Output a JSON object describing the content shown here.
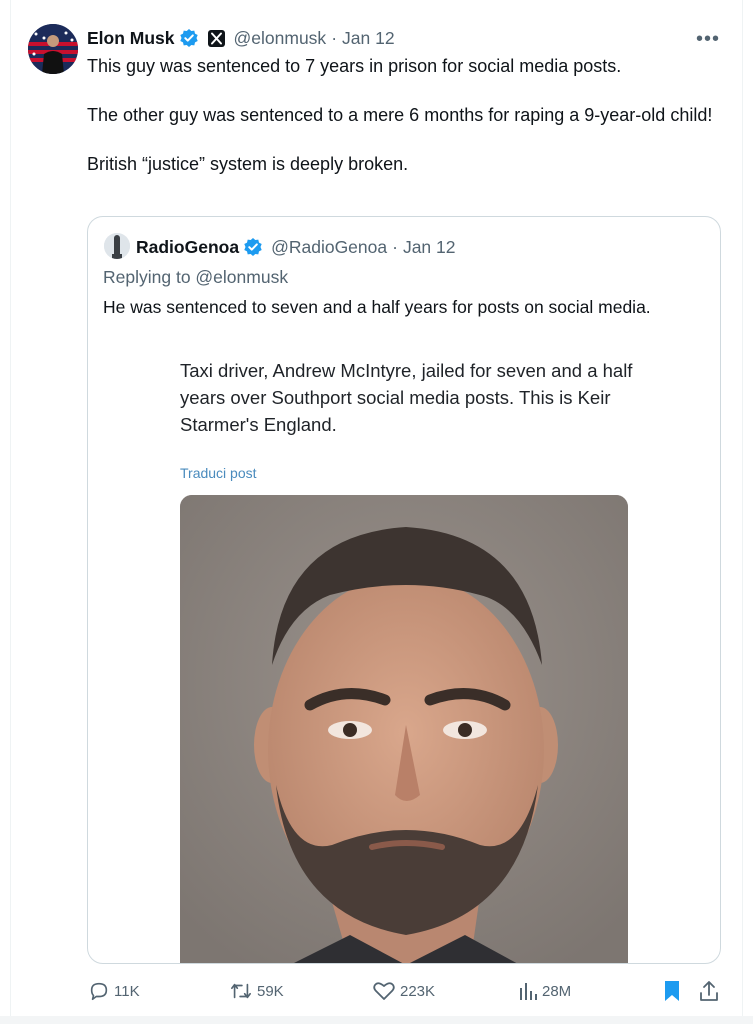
{
  "tweet": {
    "author_name": "Elon Musk",
    "handle": "@elonmusk",
    "separator": "·",
    "date": "Jan 12",
    "more_label": "•••",
    "text_lines": [
      "This guy was sentenced to 7 years in prison for social media posts.",
      "The other guy was sentenced to a mere 6 months for raping a 9-year-old child!",
      "British “justice” system is deeply broken."
    ]
  },
  "quote": {
    "author_name": "RadioGenoa",
    "handle": "@RadioGenoa",
    "separator": "·",
    "date": "Jan 12",
    "replying_to": "Replying to @elonmusk",
    "text": "He was sentenced to seven and a half years for posts on social media.",
    "embedded": {
      "text": "Taxi driver, Andrew McIntyre, jailed for seven and a half years over Southport social media posts. This is Keir Starmer's England.",
      "translate_label": "Traduci post"
    }
  },
  "actions": {
    "replies": "11K",
    "retweets": "59K",
    "likes": "223K",
    "views": "28M"
  },
  "icons": {
    "reply": "reply-icon",
    "retweet": "retweet-icon",
    "like": "heart-icon",
    "views": "views-icon",
    "bookmark": "bookmark-icon",
    "share": "share-icon",
    "verified": "verified-badge-icon",
    "x_badge": "x-logo-icon"
  },
  "colors": {
    "accent": "#1d9bf0",
    "text": "#0f1419",
    "muted": "#536471",
    "border": "#cfd9de",
    "translate_link": "#4a8bbd"
  }
}
